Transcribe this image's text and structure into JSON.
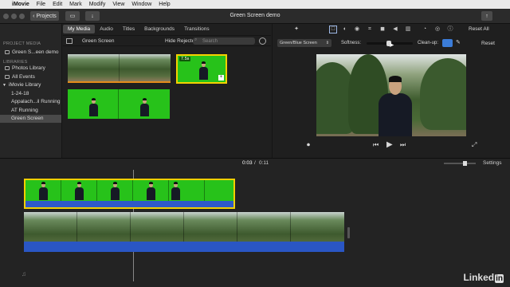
{
  "menubar": {
    "app": "iMovie",
    "items": [
      "File",
      "Edit",
      "Mark",
      "Modify",
      "View",
      "Window",
      "Help"
    ]
  },
  "toolbar": {
    "projects_label": "Projects",
    "title": "Green Screen demo"
  },
  "sidebar": {
    "project_media_header": "PROJECT MEDIA",
    "project_item": "Green S...een demo",
    "libraries_header": "LIBRARIES",
    "items": [
      "Photos Library",
      "All Events",
      "iMovie Library",
      "1-24-18",
      "Appalach...il Running",
      "AT Running",
      "Green Screen"
    ]
  },
  "browser": {
    "tabs": [
      "My Media",
      "Audio",
      "Titles",
      "Backgrounds",
      "Transitions"
    ],
    "active_tab": "My Media",
    "event_title": "Green Screen",
    "filter": "Hide Rejected",
    "search_placeholder": "Search",
    "duration_badge": "7.5s"
  },
  "adjust": {
    "effect": "Green/Blue Screen",
    "softness_label": "Softness:",
    "cleanup_label": "Clean-up:",
    "reset_label": "Reset",
    "reset_all_label": "Reset All"
  },
  "timeline": {
    "current_time": "0:03",
    "separator": "/",
    "total_time": "0:11",
    "settings_label": "Settings"
  },
  "watermark": {
    "text": "Linked",
    "suffix": "in"
  }
}
